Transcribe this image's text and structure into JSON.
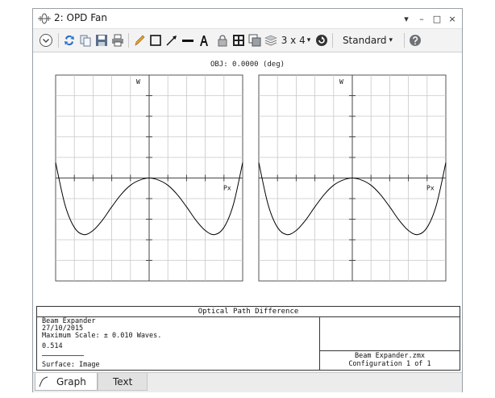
{
  "window": {
    "title": "2: OPD Fan",
    "controls": [
      "▾",
      "–",
      "□",
      "×"
    ]
  },
  "toolbar": {
    "layout_label": "3 x 4",
    "layout_caret": "▾",
    "style_label": "Standard",
    "style_caret": "▾",
    "icons": [
      "settings-icon",
      "refresh-icon",
      "copy-icon",
      "save-icon",
      "print-icon",
      "pencil-icon",
      "rectangle-icon",
      "arrow-icon",
      "line-icon",
      "text-icon",
      "lock-icon",
      "grid-icon",
      "layers-icon",
      "stack-icon",
      "auto-apply-icon",
      "help-icon"
    ]
  },
  "plot": {
    "object_label": "OBJ: 0.0000 (deg)",
    "panels": [
      {
        "y_axis_label": "W",
        "x_axis_label": "Px"
      },
      {
        "y_axis_label": "W",
        "x_axis_label": "Px"
      }
    ]
  },
  "chart_data": [
    {
      "type": "line",
      "title": "",
      "xlabel": "Px",
      "ylabel": "W",
      "xlim": [
        -1,
        1
      ],
      "ylim": [
        -0.01,
        0.01
      ],
      "grid": true,
      "series": [
        {
          "x": [
            -1.0,
            -0.9,
            -0.8,
            -0.7,
            -0.6,
            -0.5,
            -0.4,
            -0.3,
            -0.2,
            -0.1,
            0.0,
            0.1,
            0.2,
            0.3,
            0.4,
            0.5,
            0.6,
            0.7,
            0.8,
            0.9,
            1.0
          ],
          "values": [
            0.0015,
            -0.0026,
            -0.0048,
            -0.0055,
            -0.0051,
            -0.0041,
            -0.0028,
            -0.0016,
            -0.0007,
            -0.0002,
            0.0,
            -0.0002,
            -0.0007,
            -0.0016,
            -0.0028,
            -0.0041,
            -0.0051,
            -0.0055,
            -0.0048,
            -0.0026,
            0.0015
          ],
          "color": "#000000"
        }
      ]
    },
    {
      "type": "line",
      "title": "",
      "xlabel": "Px",
      "ylabel": "W",
      "xlim": [
        -1,
        1
      ],
      "ylim": [
        -0.01,
        0.01
      ],
      "grid": true,
      "series": [
        {
          "x": [
            -1.0,
            -0.9,
            -0.8,
            -0.7,
            -0.6,
            -0.5,
            -0.4,
            -0.3,
            -0.2,
            -0.1,
            0.0,
            0.1,
            0.2,
            0.3,
            0.4,
            0.5,
            0.6,
            0.7,
            0.8,
            0.9,
            1.0
          ],
          "values": [
            0.0015,
            -0.0026,
            -0.0048,
            -0.0055,
            -0.0051,
            -0.0041,
            -0.0028,
            -0.0016,
            -0.0007,
            -0.0002,
            0.0,
            -0.0002,
            -0.0007,
            -0.0016,
            -0.0028,
            -0.0041,
            -0.0051,
            -0.0055,
            -0.0048,
            -0.0026,
            0.0015
          ],
          "color": "#000000"
        }
      ]
    }
  ],
  "info": {
    "title": "Optical Path Difference",
    "lines": [
      "Beam Expander",
      "27/10/2015",
      "Maximum Scale: ± 0.010 Waves."
    ],
    "value": "0.514",
    "surface": "Surface: Image",
    "file": "Beam Expander.zmx",
    "configuration": "Configuration 1 of 1"
  },
  "tabs": [
    {
      "label": "Graph",
      "active": true
    },
    {
      "label": "Text",
      "active": false
    }
  ]
}
